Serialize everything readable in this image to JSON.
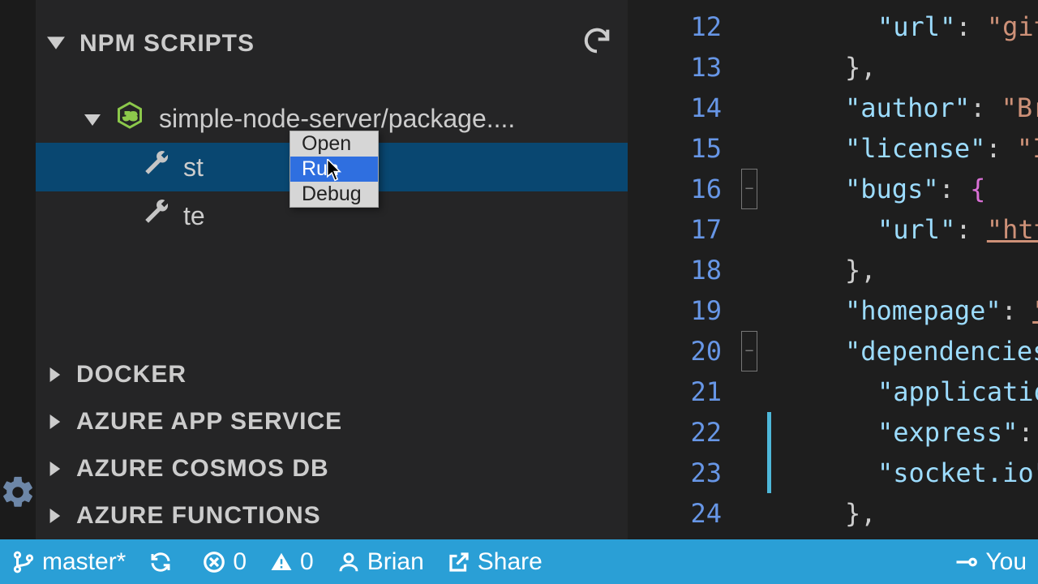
{
  "sidebar": {
    "npm_scripts": {
      "title": "NPM SCRIPTS",
      "package": "simple-node-server/package....",
      "scripts": [
        {
          "label": "st"
        },
        {
          "label": "te"
        }
      ]
    },
    "sections": [
      {
        "label": "DOCKER"
      },
      {
        "label": "AZURE APP SERVICE"
      },
      {
        "label": "AZURE COSMOS DB"
      },
      {
        "label": "AZURE FUNCTIONS"
      }
    ]
  },
  "context_menu": {
    "items": [
      {
        "label": "Open"
      },
      {
        "label": "Run",
        "hover": true
      },
      {
        "label": "Debug"
      }
    ]
  },
  "editor": {
    "lines": [
      {
        "n": 12,
        "indent": 2,
        "tokens": [
          [
            "key",
            "\"url\""
          ],
          [
            "punc",
            ": "
          ],
          [
            "str",
            "\"git+"
          ]
        ]
      },
      {
        "n": 13,
        "indent": 1,
        "tokens": [
          [
            "punc",
            "},"
          ]
        ]
      },
      {
        "n": 14,
        "indent": 1,
        "tokens": [
          [
            "key",
            "\"author\""
          ],
          [
            "punc",
            ": "
          ],
          [
            "str",
            "\"Bria"
          ]
        ]
      },
      {
        "n": 15,
        "indent": 1,
        "tokens": [
          [
            "key",
            "\"license\""
          ],
          [
            "punc",
            ": "
          ],
          [
            "str",
            "\"ISC"
          ]
        ]
      },
      {
        "n": 16,
        "indent": 1,
        "fold": true,
        "tokens": [
          [
            "key",
            "\"bugs\""
          ],
          [
            "punc",
            ": "
          ],
          [
            "brace",
            "{"
          ]
        ]
      },
      {
        "n": 17,
        "indent": 2,
        "tokens": [
          [
            "key",
            "\"url\""
          ],
          [
            "punc",
            ": "
          ],
          [
            "link",
            "\"https"
          ]
        ]
      },
      {
        "n": 18,
        "indent": 1,
        "tokens": [
          [
            "punc",
            "},"
          ]
        ]
      },
      {
        "n": 19,
        "indent": 1,
        "tokens": [
          [
            "key",
            "\"homepage\""
          ],
          [
            "punc",
            ": "
          ],
          [
            "link",
            "\"ht"
          ]
        ]
      },
      {
        "n": 20,
        "indent": 1,
        "fold": true,
        "tokens": [
          [
            "key",
            "\"dependencies\""
          ]
        ]
      },
      {
        "n": 21,
        "indent": 2,
        "tokens": [
          [
            "key",
            "\"application"
          ]
        ]
      },
      {
        "n": 22,
        "indent": 2,
        "change": true,
        "tokens": [
          [
            "key",
            "\"express\""
          ],
          [
            "punc",
            ": "
          ],
          [
            "str",
            "\""
          ]
        ]
      },
      {
        "n": 23,
        "indent": 2,
        "change": true,
        "tokens": [
          [
            "key",
            "\"socket.io\""
          ],
          [
            "punc",
            ":"
          ]
        ]
      },
      {
        "n": 24,
        "indent": 1,
        "tokens": [
          [
            "punc",
            "},"
          ]
        ]
      }
    ]
  },
  "status": {
    "branch": "master*",
    "errors": "0",
    "warnings": "0",
    "user": "Brian",
    "share": "Share",
    "right": "You"
  }
}
